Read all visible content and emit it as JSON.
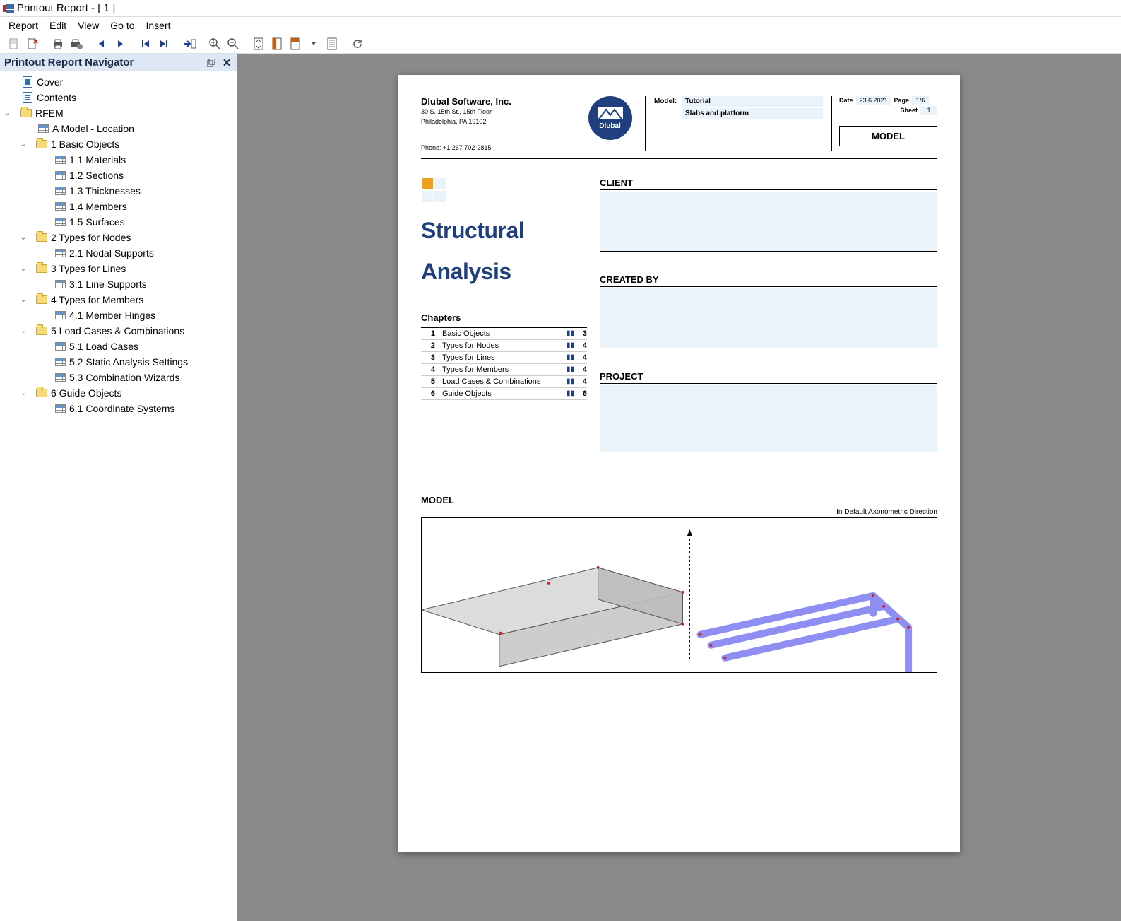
{
  "window": {
    "title": "Printout Report - [ 1 ]"
  },
  "menu": {
    "items": [
      "Report",
      "Edit",
      "View",
      "Go to",
      "Insert"
    ]
  },
  "navigator": {
    "title": "Printout Report Navigator",
    "tree": {
      "cover": "Cover",
      "contents": "Contents",
      "rfem": "RFEM",
      "a_model": "A Model - Location",
      "basic_objects": "1 Basic Objects",
      "materials": "1.1 Materials",
      "sections": "1.2 Sections",
      "thicknesses": "1.3 Thicknesses",
      "members": "1.4 Members",
      "surfaces": "1.5 Surfaces",
      "types_nodes": "2 Types for Nodes",
      "nodal_supports": "2.1 Nodal Supports",
      "types_lines": "3 Types for Lines",
      "line_supports": "3.1 Line Supports",
      "types_members": "4 Types for Members",
      "member_hinges": "4.1 Member Hinges",
      "load_cases": "5 Load Cases & Combinations",
      "lc": "5.1 Load Cases",
      "sas": "5.2 Static Analysis Settings",
      "cw": "5.3 Combination Wizards",
      "guide": "6 Guide Objects",
      "coord": "6.1 Coordinate Systems"
    }
  },
  "report": {
    "company": "Dlubal Software, Inc.",
    "addr1": "30 S. 15th St., 15th Floor",
    "addr2": "Philadelphia, PA 19102",
    "phone": "Phone: +1 267 702-2815",
    "logo_text": "Dlubal",
    "model_lbl": "Model:",
    "model_val": "Tutorial",
    "model_sub": "Slabs and platform",
    "date_lbl": "Date",
    "date_val": "23.6.2021",
    "page_lbl": "Page",
    "page_val": "1/6",
    "sheet_lbl": "Sheet",
    "sheet_val": "1",
    "model_box": "MODEL",
    "title1": "Structural",
    "title2": "Analysis",
    "chapters_label": "Chapters",
    "chapters": [
      {
        "n": "1",
        "name": "Basic Objects",
        "pg": "3"
      },
      {
        "n": "2",
        "name": "Types for Nodes",
        "pg": "4"
      },
      {
        "n": "3",
        "name": "Types for Lines",
        "pg": "4"
      },
      {
        "n": "4",
        "name": "Types for Members",
        "pg": "4"
      },
      {
        "n": "5",
        "name": "Load Cases & Combinations",
        "pg": "4"
      },
      {
        "n": "6",
        "name": "Guide Objects",
        "pg": "6"
      }
    ],
    "sec_client": "CLIENT",
    "sec_created": "CREATED BY",
    "sec_project": "PROJECT",
    "model_head": "MODEL",
    "model_sub_dir": "In Default Axonometric Direction"
  }
}
